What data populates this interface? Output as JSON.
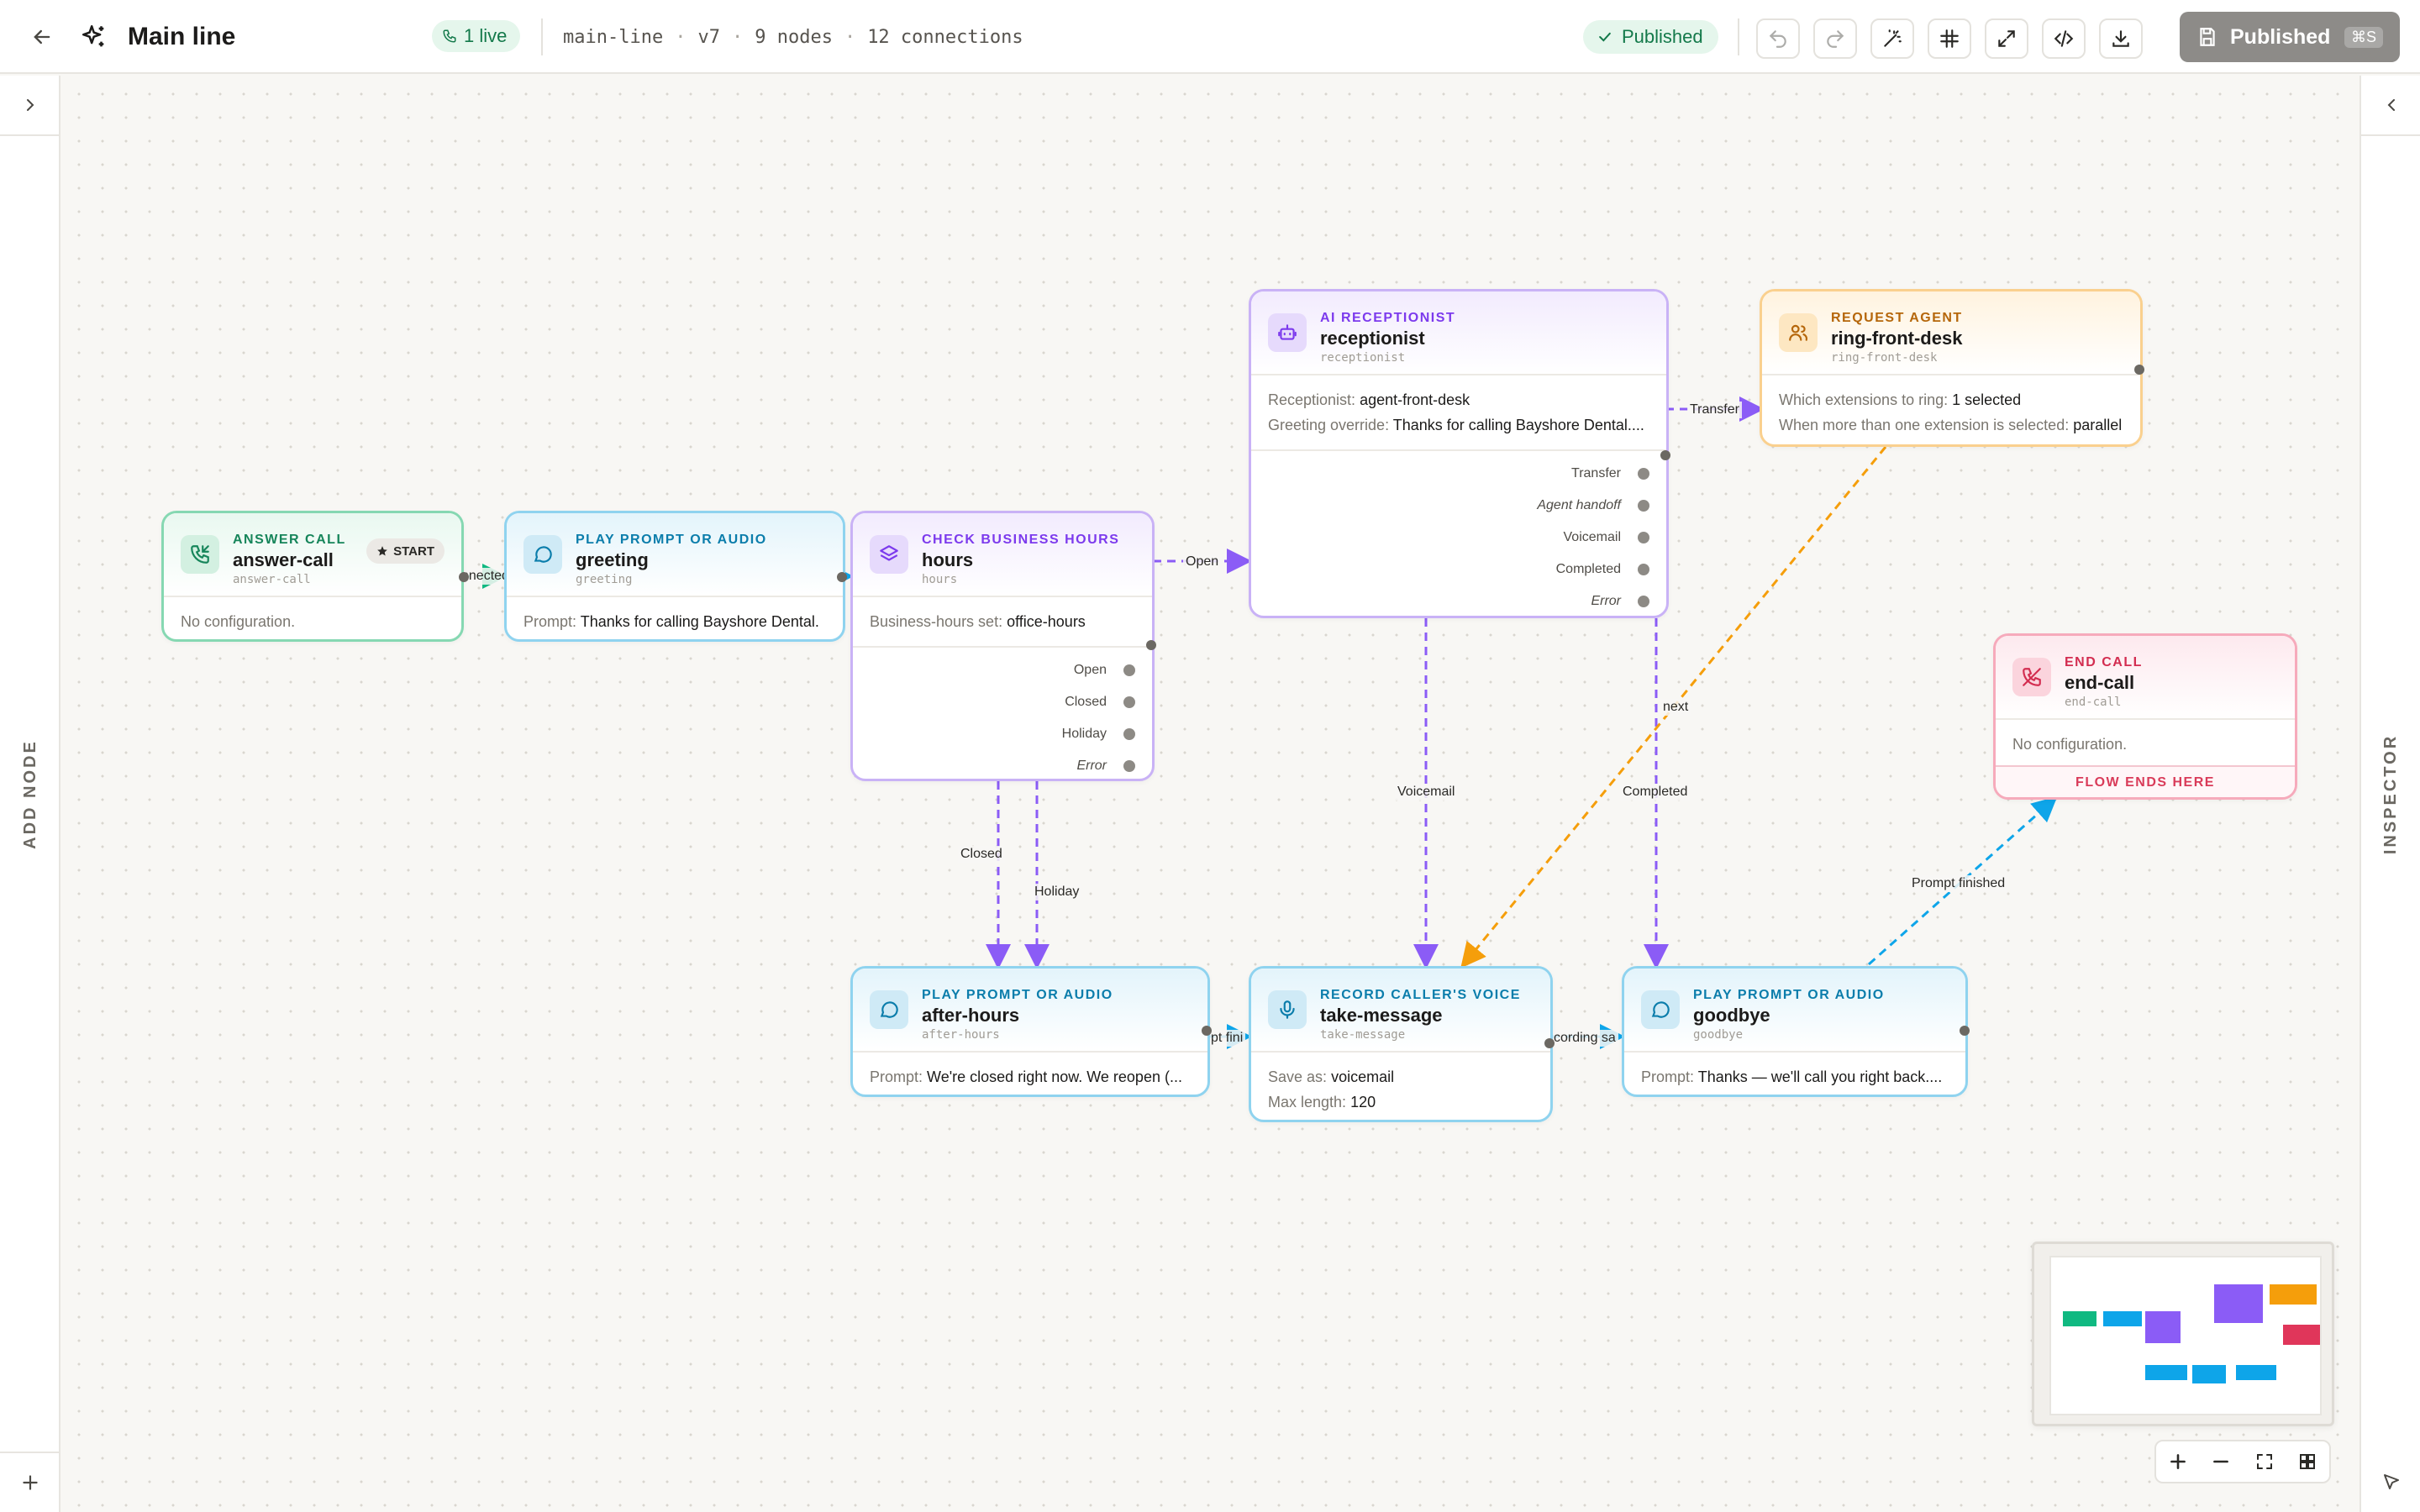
{
  "header": {
    "title": "Main line",
    "live_label": "1 live",
    "slug": "main-line",
    "version": "v7",
    "nodes": "9 nodes",
    "connections": "12 connections",
    "sep": "·",
    "status": "Published",
    "publish_label": "Published",
    "publish_shortcut": "⌘S"
  },
  "left_rail": {
    "label": "ADD NODE"
  },
  "right_rail": {
    "label": "INSPECTOR"
  },
  "nodes": {
    "answer": {
      "type": "ANSWER CALL",
      "name": "answer-call",
      "id": "answer-call",
      "badge": "START",
      "empty": "No configuration."
    },
    "greeting": {
      "type": "PLAY PROMPT OR AUDIO",
      "name": "greeting",
      "id": "greeting",
      "k1": "Prompt:",
      "v1": "Thanks for calling Bayshore Dental."
    },
    "hours": {
      "type": "CHECK BUSINESS HOURS",
      "name": "hours",
      "id": "hours",
      "k1": "Business-hours set:",
      "v1": "office-hours",
      "outputs": [
        "Open",
        "Closed",
        "Holiday",
        "Error"
      ]
    },
    "receptionist": {
      "type": "AI RECEPTIONIST",
      "name": "receptionist",
      "id": "receptionist",
      "k1": "Receptionist:",
      "v1": "agent-front-desk",
      "k2": "Greeting override:",
      "v2": "Thanks for calling Bayshore Dental....",
      "outputs": [
        "Transfer",
        "Agent handoff",
        "Voicemail",
        "Completed",
        "Error"
      ]
    },
    "ring": {
      "type": "REQUEST AGENT",
      "name": "ring-front-desk",
      "id": "ring-front-desk",
      "k1": "Which extensions to ring:",
      "v1": "1 selected",
      "k2": "When more than one extension is selected:",
      "v2": "parallel"
    },
    "endcall": {
      "type": "END CALL",
      "name": "end-call",
      "id": "end-call",
      "empty": "No configuration.",
      "footer": "FLOW ENDS HERE"
    },
    "afterhours": {
      "type": "PLAY PROMPT OR AUDIO",
      "name": "after-hours",
      "id": "after-hours",
      "k1": "Prompt:",
      "v1": "We're closed right now. We reopen (..."
    },
    "takemessage": {
      "type": "RECORD CALLER'S VOICE",
      "name": "take-message",
      "id": "take-message",
      "k1": "Save as:",
      "v1": "voicemail",
      "k2": "Max length:",
      "v2": "120"
    },
    "goodbye": {
      "type": "PLAY PROMPT OR AUDIO",
      "name": "goodbye",
      "id": "goodbye",
      "k1": "Prompt:",
      "v1": "Thanks — we'll call you right back...."
    }
  },
  "edge_labels": {
    "connected": "nnected",
    "open": "Open",
    "transfer": "Transfer",
    "closed": "Closed",
    "holiday": "Holiday",
    "voicemail": "Voicemail",
    "next": "next",
    "completed": "Completed",
    "prompt_finished": "Prompt finished",
    "prompt_finished_clip": "pt fini",
    "recording_saved_clip": "cording sa"
  },
  "colors": {
    "purple_edge": "#8b5cf6",
    "orange_edge": "#f59e0b",
    "blue_edge": "#0ea5e9",
    "green_edge": "#10b981"
  },
  "icons": {
    "back": "arrow-left-icon",
    "logo": "sparkle-icon",
    "undo": "undo-icon",
    "redo": "redo-icon",
    "auto_layout": "magic-wand-icon",
    "grid": "hash-icon",
    "expand": "expand-icon",
    "code": "code-icon",
    "download": "download-icon",
    "save": "save-icon"
  }
}
